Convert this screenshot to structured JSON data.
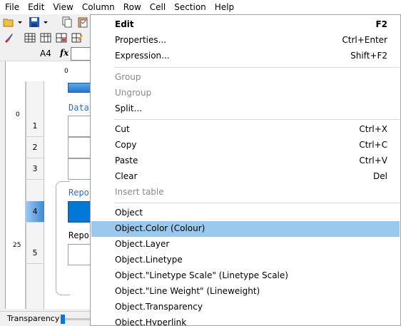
{
  "menubar": {
    "items": [
      "File",
      "Edit",
      "View",
      "Column",
      "Row",
      "Cell",
      "Section",
      "Help"
    ]
  },
  "formula_bar": {
    "cell_ref": "A4",
    "fx_label": "fx"
  },
  "editor": {
    "ruler_h_zero": "0",
    "ruler_v_marks": [
      "0",
      "25"
    ],
    "rows": [
      "1",
      "2",
      "3",
      "4",
      "5"
    ],
    "selected_row": "4",
    "text_data": "Data",
    "text_repo1": "Repo",
    "text_repo2": "Repo"
  },
  "status": {
    "transparency_label": "Transparency"
  },
  "colors": {
    "selection_blue": "#0078d7",
    "menu_highlight": "#99c9ef"
  },
  "context_menu": {
    "items": [
      {
        "label": "Edit",
        "shortcut": "F2",
        "bold": true
      },
      {
        "label": "Properties...",
        "shortcut": "Ctrl+Enter"
      },
      {
        "label": "Expression...",
        "shortcut": "Shift+F2"
      },
      {
        "label": "Group",
        "shortcut": "",
        "disabled": true
      },
      {
        "label": "Ungroup",
        "shortcut": "",
        "disabled": true
      },
      {
        "label": "Split...",
        "shortcut": ""
      },
      {
        "label": "Cut",
        "shortcut": "Ctrl+X"
      },
      {
        "label": "Copy",
        "shortcut": "Ctrl+C"
      },
      {
        "label": "Paste",
        "shortcut": "Ctrl+V"
      },
      {
        "label": "Clear",
        "shortcut": "Del"
      },
      {
        "label": "Insert table",
        "shortcut": "",
        "disabled": true
      },
      {
        "label": "Object",
        "shortcut": ""
      },
      {
        "label": "Object.Color (Colour)",
        "shortcut": "",
        "highlighted": true
      },
      {
        "label": "Object.Layer",
        "shortcut": ""
      },
      {
        "label": "Object.Linetype",
        "shortcut": ""
      },
      {
        "label": "Object.\"Linetype Scale\" (Linetype Scale)",
        "shortcut": ""
      },
      {
        "label": "Object.\"Line Weight\" (Lineweight)",
        "shortcut": ""
      },
      {
        "label": "Object.Transparency",
        "shortcut": ""
      },
      {
        "label": "Object.Hyperlink",
        "shortcut": ""
      }
    ]
  }
}
